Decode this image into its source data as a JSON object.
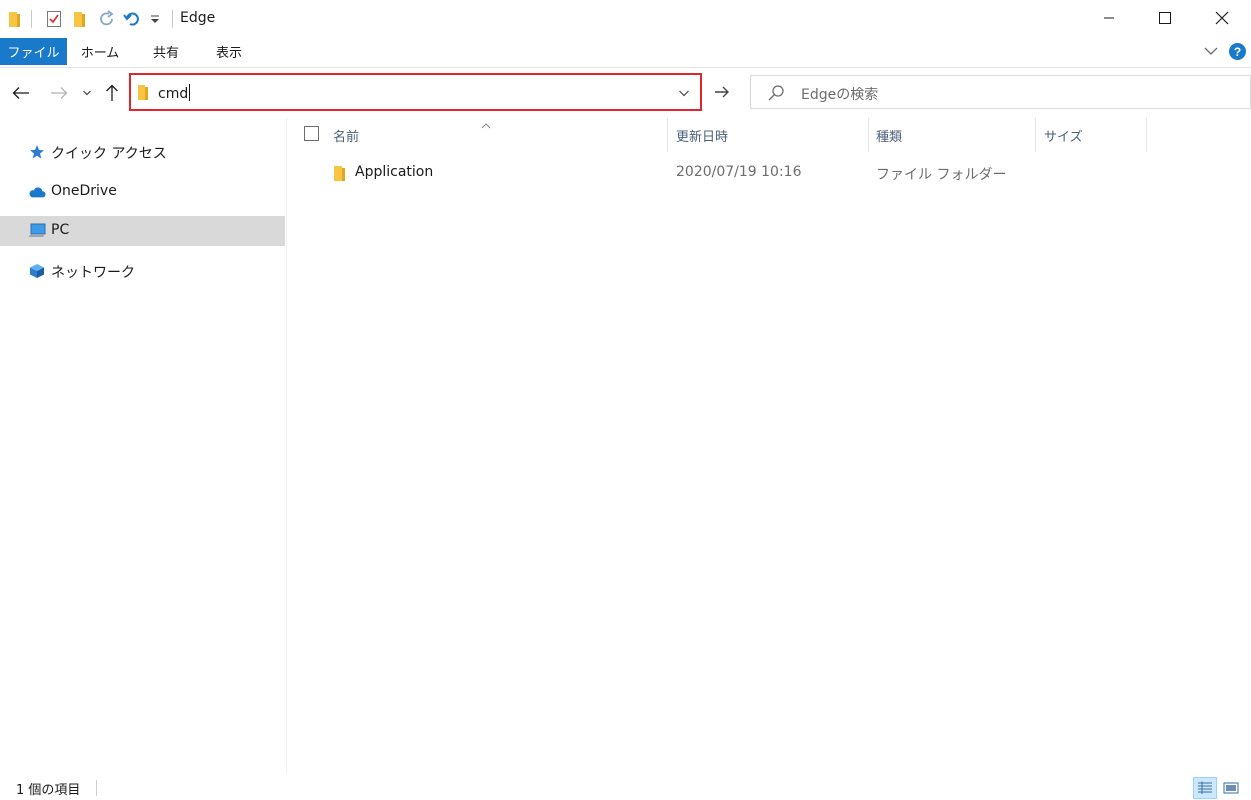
{
  "window": {
    "title": "Edge",
    "controls": {
      "minimize": "minimize",
      "maximize": "maximize",
      "close": "close"
    }
  },
  "ribbon": {
    "tabs": [
      "ファイル",
      "ホーム",
      "共有",
      "表示"
    ],
    "help_label": "?"
  },
  "navigation": {
    "address_value": "cmd",
    "search_placeholder": "Edgeの検索"
  },
  "sidebar": {
    "items": [
      {
        "label": "クイック アクセス",
        "icon": "star-icon"
      },
      {
        "label": "OneDrive",
        "icon": "cloud-icon"
      },
      {
        "label": "PC",
        "icon": "computer-icon",
        "selected": true
      },
      {
        "label": "ネットワーク",
        "icon": "network-icon"
      }
    ]
  },
  "columns": {
    "name": "名前",
    "date": "更新日時",
    "type": "種類",
    "size": "サイズ"
  },
  "files": [
    {
      "name": "Application",
      "date": "2020/07/19 10:16",
      "type": "ファイル フォルダー",
      "size": ""
    }
  ],
  "status": {
    "text": "1 個の項目"
  },
  "colors": {
    "accent": "#1979ca",
    "highlight_border": "#e0262c",
    "folder": "#f8c542",
    "selected_bg": "#d9d9d9"
  }
}
